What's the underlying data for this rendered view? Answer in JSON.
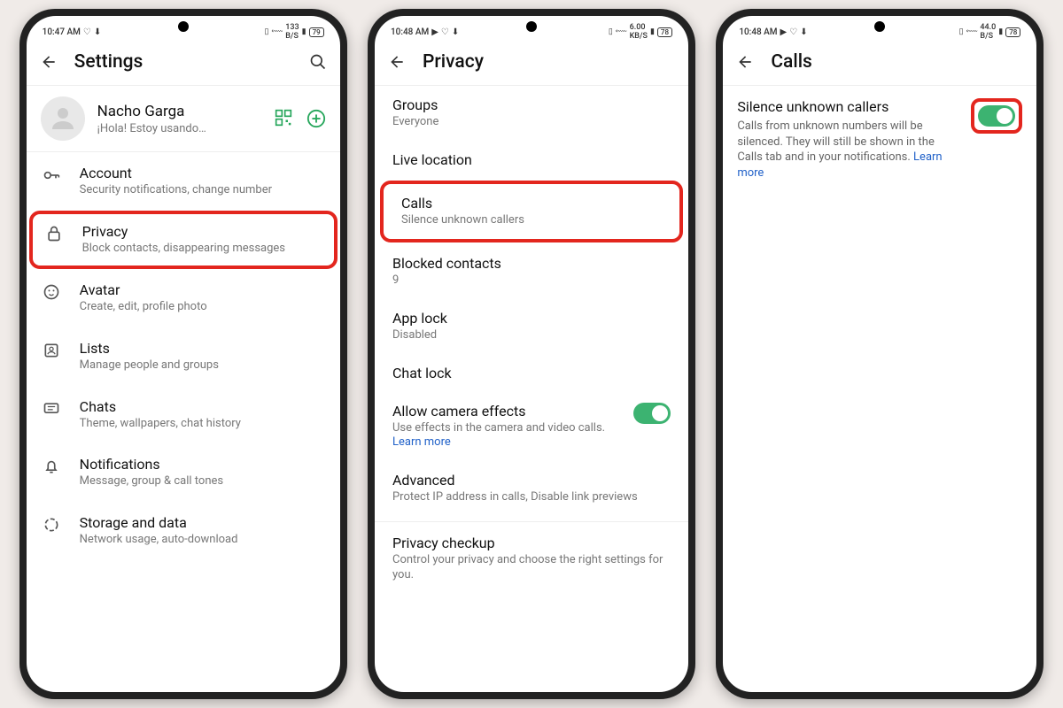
{
  "phone1": {
    "time": "10:47 AM",
    "net": "133",
    "netUnit": "B/S",
    "battery": "79",
    "title": "Settings",
    "profile": {
      "name": "Nacho Garga",
      "status": "¡Hola! Estoy usando…"
    },
    "items": {
      "account": {
        "title": "Account",
        "sub": "Security notifications, change number"
      },
      "privacy": {
        "title": "Privacy",
        "sub": "Block contacts, disappearing messages"
      },
      "avatar": {
        "title": "Avatar",
        "sub": "Create, edit, profile photo"
      },
      "lists": {
        "title": "Lists",
        "sub": "Manage people and groups"
      },
      "chats": {
        "title": "Chats",
        "sub": "Theme, wallpapers, chat history"
      },
      "notifications": {
        "title": "Notifications",
        "sub": "Message, group & call tones"
      },
      "storage": {
        "title": "Storage and data",
        "sub": "Network usage, auto-download"
      }
    }
  },
  "phone2": {
    "time": "10:48 AM",
    "net": "6.00",
    "netUnit": "KB/S",
    "battery": "78",
    "title": "Privacy",
    "groups": {
      "title": "Groups",
      "sub": "Everyone"
    },
    "live": {
      "title": "Live location"
    },
    "calls": {
      "title": "Calls",
      "sub": "Silence unknown callers"
    },
    "blocked": {
      "title": "Blocked contacts",
      "sub": "9"
    },
    "applock": {
      "title": "App lock",
      "sub": "Disabled"
    },
    "chatlock": {
      "title": "Chat lock"
    },
    "camera": {
      "title": "Allow camera effects",
      "sub": "Use effects in the camera and video calls. ",
      "learn": "Learn more"
    },
    "advanced": {
      "title": "Advanced",
      "sub": "Protect IP address in calls, Disable link previews"
    },
    "checkup": {
      "title": "Privacy checkup",
      "sub": "Control your privacy and choose the right settings for you."
    }
  },
  "phone3": {
    "time": "10:48 AM",
    "net": "44.0",
    "netUnit": "B/S",
    "battery": "78",
    "title": "Calls",
    "silence": {
      "title": "Silence unknown callers",
      "desc": "Calls from unknown numbers will be silenced. They will still be shown in the Calls tab and in your notifications. ",
      "learn": "Learn more"
    }
  }
}
